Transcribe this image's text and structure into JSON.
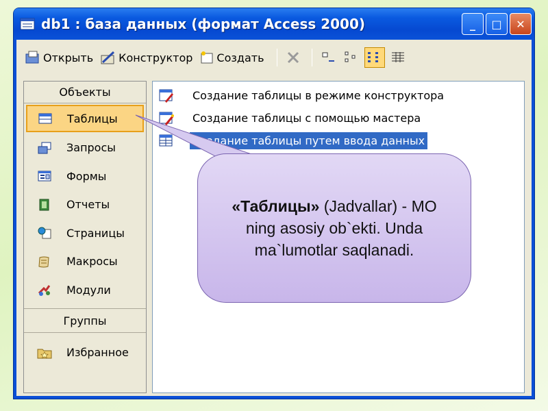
{
  "window": {
    "title": "db1 : база данных (формат Access 2000)"
  },
  "title_buttons": {
    "minimize": "_",
    "maximize": "□",
    "close": "✕"
  },
  "toolbar": {
    "open_label": "Открыть",
    "design_label": "Конструктор",
    "create_label": "Создать"
  },
  "objects": {
    "header": "Объекты",
    "items": [
      {
        "label": "Таблицы",
        "icon": "table-icon"
      },
      {
        "label": "Запросы",
        "icon": "query-icon"
      },
      {
        "label": "Формы",
        "icon": "form-icon"
      },
      {
        "label": "Отчеты",
        "icon": "report-icon"
      },
      {
        "label": "Страницы",
        "icon": "page-icon"
      },
      {
        "label": "Макросы",
        "icon": "macro-icon"
      },
      {
        "label": "Модули",
        "icon": "module-icon"
      }
    ],
    "groups_header": "Группы",
    "favorites": "Избранное"
  },
  "list": {
    "items": [
      "Создание таблицы в режиме конструктора",
      "Создание таблицы с помощью мастера",
      "Создание таблицы путем ввода данных"
    ]
  },
  "callout": {
    "title": "«Таблицы»",
    "text": " (Jadvallar) - MO ning asosiy ob`ekti. Unda ma`lumotlar saqlanadi."
  },
  "colors": {
    "selection": "#316ac5",
    "selected_object": "#fbd584",
    "titlebar": "#0a5ae0",
    "callout": "#c8b6ea"
  }
}
